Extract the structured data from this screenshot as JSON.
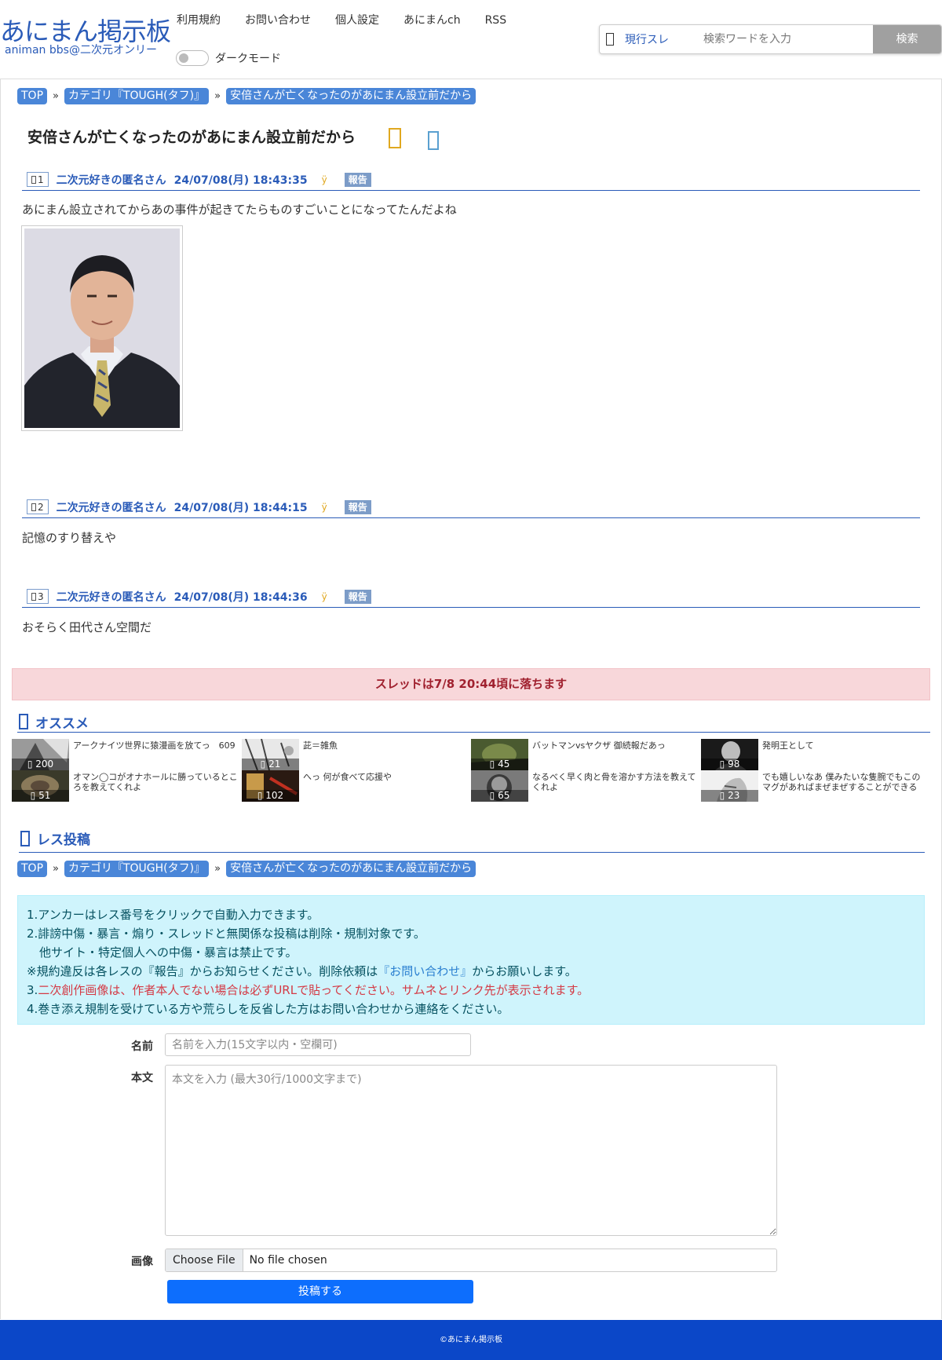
{
  "site": {
    "logo_main": "あにまん掲示板",
    "logo_sub": "animan bbs@二次元オンリー"
  },
  "nav": {
    "items": [
      "利用規約",
      "お問い合わせ",
      "個人設定",
      "あにまんch",
      "RSS"
    ],
    "darkmode_label": "ダークモード"
  },
  "search": {
    "scope": "現行スレ",
    "placeholder": "検索ワードを入力",
    "button": "検索"
  },
  "breadcrumb": {
    "top": "TOP",
    "sep": "»",
    "category": "カテゴリ『TOUGH(タフ)』",
    "thread": "安倍さんが亡くなったのがあにまん設立前だから"
  },
  "thread": {
    "title": "安倍さんが亡くなったのがあにまん設立前だから"
  },
  "posts": [
    {
      "num": "1",
      "name": "二次元好きの匿名さん",
      "date": "24/07/08(月) 18:43:35",
      "id": "ÿ",
      "report": "報告",
      "body": "あにまん設立されてからあの事件が起きてたらものすごいことになってたんだよね"
    },
    {
      "num": "2",
      "name": "二次元好きの匿名さん",
      "date": "24/07/08(月) 18:44:15",
      "id": "ÿ",
      "report": "報告",
      "body": "記憶のすり替えや"
    },
    {
      "num": "3",
      "name": "二次元好きの匿名さん",
      "date": "24/07/08(月) 18:44:36",
      "id": "ÿ",
      "report": "報告",
      "body": "おそらく田代さん空間だ"
    }
  ],
  "notice_fall": "スレッドは7/8 20:44頃に落ちます",
  "recommend": {
    "heading": "オススメ",
    "items": [
      {
        "text": "アークナイツ世界に猿漫画を放てっ　609",
        "count": "200"
      },
      {
        "text": "茈＝雑魚",
        "count": "21"
      },
      {
        "text": "バットマンvsヤクザ 御続報だあっ",
        "count": "45"
      },
      {
        "text": "発明王として",
        "count": "98"
      },
      {
        "text": "オマン◯コがオナホールに勝っているところを教えてくれよ",
        "count": "51"
      },
      {
        "text": "へっ 何が食べて応援や",
        "count": "102"
      },
      {
        "text": "なるべく早く肉と骨を溶かす方法を教えてくれよ",
        "count": "65"
      },
      {
        "text": "でも嬉しいなあ 僕みたいな隻腕でもこのマグがあればまぜまぜすることができる",
        "count": "23"
      }
    ]
  },
  "reply": {
    "heading": "レス投稿",
    "rules": {
      "r1": "1.アンカーはレス番号をクリックで自動入力できます。",
      "r2": "2.誹謗中傷・暴言・煽り・スレッドと無関係な投稿は削除・規制対象です。",
      "r2b": "他サイト・特定個人への中傷・暴言は禁止です。",
      "r2c_a": "※規約違反は各レスの『報告』からお知らせください。削除依頼は",
      "r2c_link": "『お問い合わせ』",
      "r2c_b": "からお願いします。",
      "r3_a": "3.",
      "r3_red": "二次創作画像は、作者本人でない場合は必ずURLで貼ってください。サムネとリンク先が表示されます。",
      "r4": "4.巻き添え規制を受けている方や荒らしを反省した方はお問い合わせから連絡をください。"
    },
    "name_label": "名前",
    "name_placeholder": "名前を入力(15文字以内・空欄可)",
    "body_label": "本文",
    "body_placeholder": "本文を入力 (最大30行/1000文字まで)",
    "image_label": "画像",
    "file_button": "Choose File",
    "file_status": "No file chosen",
    "submit": "投稿する"
  },
  "footer": "©あにまん掲示板",
  "colors": {
    "accent": "#2a5bb8",
    "chip": "#4a86d8",
    "footer": "#0b47c8",
    "submit": "#0d6efd"
  }
}
